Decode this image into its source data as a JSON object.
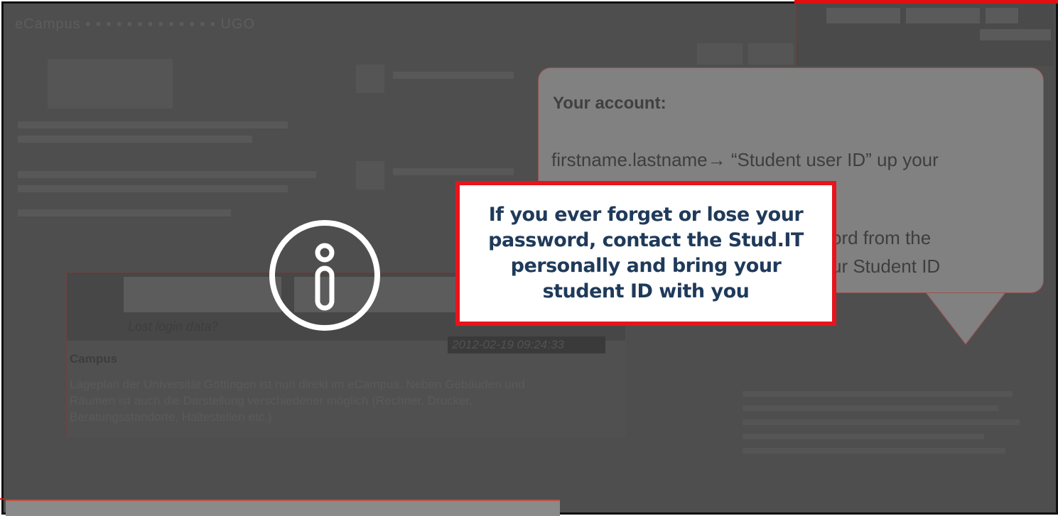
{
  "background_page": {
    "title_fragment": "ⅈⅈⅈⅈⅈⅈⅈⅈⅈⅈⅈⅈⅈⅈⅈⅈⅈⅈⅈⅈⅈⅈⅈⅈⅈⅈ ⅈⅈⅈⅈ",
    "lost_login_link": "Lost login data?",
    "timestamp": "2012-02-19 09:24:33",
    "campus_heading": "Campus",
    "campus_text": "Lageplan der Universität Göttingen ist nun direkt im eCampus. Neben Gebäuden und Räumen ist auch die Darstellung verschiedener möglich (Rechner, Drucker, Beratungsstandorte, Haltestellen etc.)"
  },
  "bubble": {
    "heading": "Your account:",
    "line1": "firstname.lastname→ “Student user ID” up your",
    "fragment2": "ord from the",
    "fragment3": "ur Student ID"
  },
  "callout": {
    "text": "If you ever forget or lose your password, contact the Stud.IT personally  and bring your student ID with you"
  },
  "colors": {
    "overlay": "#4e4e4e",
    "callout_border": "#e8141c",
    "callout_text": "#1f3a5a",
    "bubble_bg": "#818181"
  },
  "icons": {
    "info": "info-icon"
  }
}
